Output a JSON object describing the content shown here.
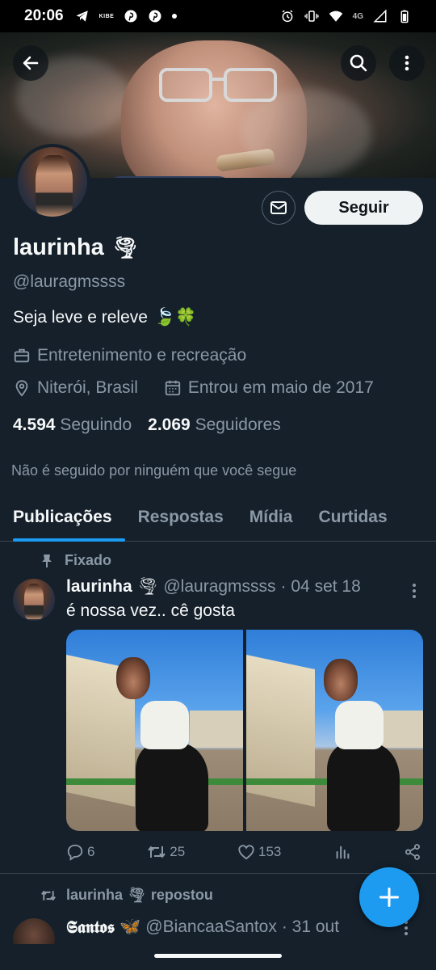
{
  "status_bar": {
    "time": "20:06",
    "left_icons": [
      "telegram-icon",
      "kibe-icon",
      "pinterest-icon",
      "pinterest-icon",
      "dot-icon"
    ],
    "kibe_text": "KIBE",
    "network": "4G",
    "right_icons": [
      "alarm-icon",
      "vibrate-icon",
      "wifi-icon",
      "signal-icon",
      "battery-icon"
    ]
  },
  "header": {
    "back_icon": "arrow-left-icon",
    "search_icon": "search-icon",
    "more_icon": "more-vertical-icon"
  },
  "profile": {
    "name": "laurinha",
    "name_emoji": "🌪",
    "handle": "@lauragmssss",
    "bio": "Seja leve e releve",
    "bio_emojis": "🍃🍀",
    "category": "Entretenimento e recreação",
    "location": "Niterói, Brasil",
    "joined": "Entrou em maio de 2017",
    "following_count": "4.594",
    "following_label": "Seguindo",
    "followers_count": "2.069",
    "followers_label": "Seguidores",
    "not_followed_text": "Não é seguido por ninguém que você segue",
    "follow_button": "Seguir",
    "message_icon": "envelope-icon"
  },
  "tabs": [
    {
      "label": "Publicações",
      "active": true
    },
    {
      "label": "Respostas",
      "active": false
    },
    {
      "label": "Mídia",
      "active": false
    },
    {
      "label": "Curtidas",
      "active": false
    }
  ],
  "pinned_post": {
    "pinned_label": "Fixado",
    "author_name": "laurinha",
    "author_emoji": "🌪",
    "author_handle": "@lauragmssss",
    "date": "· 04 set 18",
    "text": "é nossa vez.. cê gosta",
    "replies": "6",
    "reposts": "25",
    "likes": "153"
  },
  "repost": {
    "repost_label": "laurinha",
    "repost_emoji": "🌪",
    "repost_suffix": "repostou",
    "author_name": "𝕾𝖆𝖓𝖙𝖔𝖘",
    "author_emoji": "🦋",
    "author_handle": "@BiancaaSantox",
    "date": "· 31 out"
  },
  "colors": {
    "background": "#15202b",
    "accent": "#1d9bf0",
    "muted_text": "#8b98a5",
    "border": "#38444d"
  }
}
